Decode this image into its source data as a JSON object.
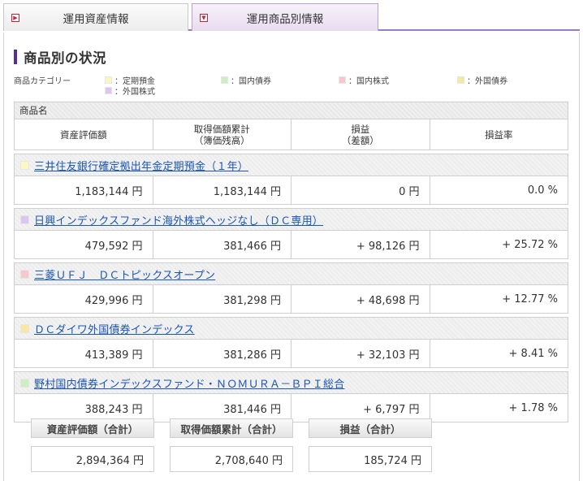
{
  "tabs": [
    {
      "label": "運用資産情報"
    },
    {
      "label": "運用商品別情報"
    }
  ],
  "heading": "商品別の状況",
  "legend": {
    "label": "商品カテゴリー",
    "items": [
      {
        "label": "：定期預金",
        "color": "#fbf6c4"
      },
      {
        "label": "：国内債券",
        "color": "#cdeec0"
      },
      {
        "label": "：国内株式",
        "color": "#f8c7cd"
      },
      {
        "label": "：外国債券",
        "color": "#f8e7a2"
      },
      {
        "label": "：外国株式",
        "color": "#dcc6ee"
      }
    ]
  },
  "table": {
    "name_header": "商品名",
    "columns": [
      {
        "line1": "資産評価額",
        "line2": ""
      },
      {
        "line1": "取得価額累計",
        "line2": "（簿価残高）"
      },
      {
        "line1": "損益",
        "line2": "（差額）"
      },
      {
        "line1": "損益率",
        "line2": ""
      }
    ],
    "products": [
      {
        "name": "三井住友銀行確定拠出年金定期預金（１年）",
        "color": "#fbf6c4",
        "values": [
          "1,183,144 円",
          "1,183,144 円",
          "0 円",
          "0.0 %"
        ]
      },
      {
        "name": "日興インデックスファンド海外株式ヘッジなし（ＤＣ専用）",
        "color": "#dcc6ee",
        "values": [
          "479,592 円",
          "381,466 円",
          "+ 98,126 円",
          "+ 25.72 %"
        ]
      },
      {
        "name": "三菱ＵＦＪ　ＤＣトピックスオープン",
        "color": "#f8c7cd",
        "values": [
          "429,996 円",
          "381,298 円",
          "+ 48,698 円",
          "+ 12.77 %"
        ]
      },
      {
        "name": "ＤＣダイワ外国債券インデックス",
        "color": "#f8e7a2",
        "values": [
          "413,389 円",
          "381,286 円",
          "+ 32,103 円",
          "+ 8.41 %"
        ]
      },
      {
        "name": "野村国内債券インデックスファンド・ＮＯＭＵＲＡ－ＢＰＩ総合",
        "color": "#cdeec0",
        "values": [
          "388,243 円",
          "381,446 円",
          "+ 6,797 円",
          "+ 1.78 %"
        ]
      }
    ]
  },
  "totals": [
    {
      "label": "資産評価額（合計）",
      "value": "2,894,364 円"
    },
    {
      "label": "取得価額累計（合計）",
      "value": "2,708,640 円"
    },
    {
      "label": "損益（合計）",
      "value": "185,724 円"
    }
  ]
}
